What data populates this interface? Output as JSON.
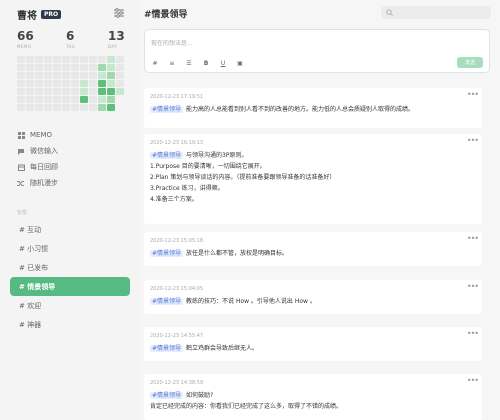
{
  "brand": {
    "name": "曹将",
    "badge": "PRO"
  },
  "stats": [
    {
      "value": "66",
      "label": "MEMO"
    },
    {
      "value": "6",
      "label": "TAG"
    },
    {
      "value": "13",
      "label": "DAY"
    }
  ],
  "heatmap": [
    [
      0,
      0,
      0,
      0,
      0,
      0,
      0,
      0,
      0,
      0,
      1,
      0
    ],
    [
      0,
      0,
      0,
      0,
      0,
      0,
      0,
      0,
      0,
      2,
      1,
      0
    ],
    [
      0,
      0,
      0,
      0,
      0,
      0,
      0,
      0,
      0,
      1,
      2,
      0
    ],
    [
      0,
      0,
      0,
      0,
      0,
      0,
      0,
      1,
      0,
      3,
      1,
      0
    ],
    [
      0,
      0,
      0,
      0,
      0,
      0,
      0,
      1,
      0,
      3,
      3,
      1
    ],
    [
      0,
      0,
      0,
      0,
      0,
      0,
      0,
      3,
      0,
      1,
      2,
      -1
    ],
    [
      0,
      0,
      0,
      0,
      0,
      0,
      0,
      0,
      0,
      2,
      3,
      -1
    ]
  ],
  "nav": [
    {
      "icon": "grid-icon",
      "label": "MEMO"
    },
    {
      "icon": "chat-icon",
      "label": "微信输入"
    },
    {
      "icon": "calendar-icon",
      "label": "每日回顾"
    },
    {
      "icon": "shuffle-icon",
      "label": "随机漫步"
    }
  ],
  "tags_header": "标签",
  "tags": [
    {
      "label": "# 互动",
      "active": false
    },
    {
      "label": "# 小习惯",
      "active": false
    },
    {
      "label": "# 已发布",
      "active": false
    },
    {
      "label": "# 情景领导",
      "active": true
    },
    {
      "label": "# 欢迎",
      "active": false
    },
    {
      "label": "# 神器",
      "active": false
    }
  ],
  "main": {
    "title": "#情景领导",
    "editor_placeholder": "现在的想法是...",
    "toolbar": [
      "#",
      "≡",
      "☰",
      "B",
      "U",
      "▣"
    ],
    "send_label": "发送"
  },
  "memos": [
    {
      "time": "2020-12-23 17:19:51",
      "tag": "#情景领导",
      "lines": [
        "能力高的人总能看到别人看不到的改善的地方。能力低的人总会质疑别人取得的成绩。"
      ]
    },
    {
      "time": "2020-12-23 16:19:13",
      "tag": "#情景领导",
      "lines": [
        "与领导沟通的3P原则。",
        "1.Purpose 目的要清晰，一切围绕它展开。",
        "2.Plan 策划与领导谈话的内容。（提前准备要跟领导准备的话准备好）",
        "3.Practice 练习，讲得顺。",
        "4.准备三个方案。"
      ]
    },
    {
      "time": "2020-12-23 15:05:18",
      "tag": "#情景领导",
      "lines": [
        "放任是什么都不管，放权是明确目标。"
      ]
    },
    {
      "time": "2020-12-23 15:04:05",
      "tag": "#情景领导",
      "lines": [
        "教练的技巧：不说 How 。引导他人说出 How 。"
      ]
    },
    {
      "time": "2020-12-23 14:55:47",
      "tag": "#情景领导",
      "lines": [
        "鹤立鸡群会导致后继无人。"
      ]
    },
    {
      "time": "2020-12-23 14:38:59",
      "tag": "#情景领导",
      "lines": [
        "如何鼓励?",
        "肯定已经完成的内容：你看我们已经完成了这么多，取得了不错的成绩。"
      ]
    }
  ]
}
